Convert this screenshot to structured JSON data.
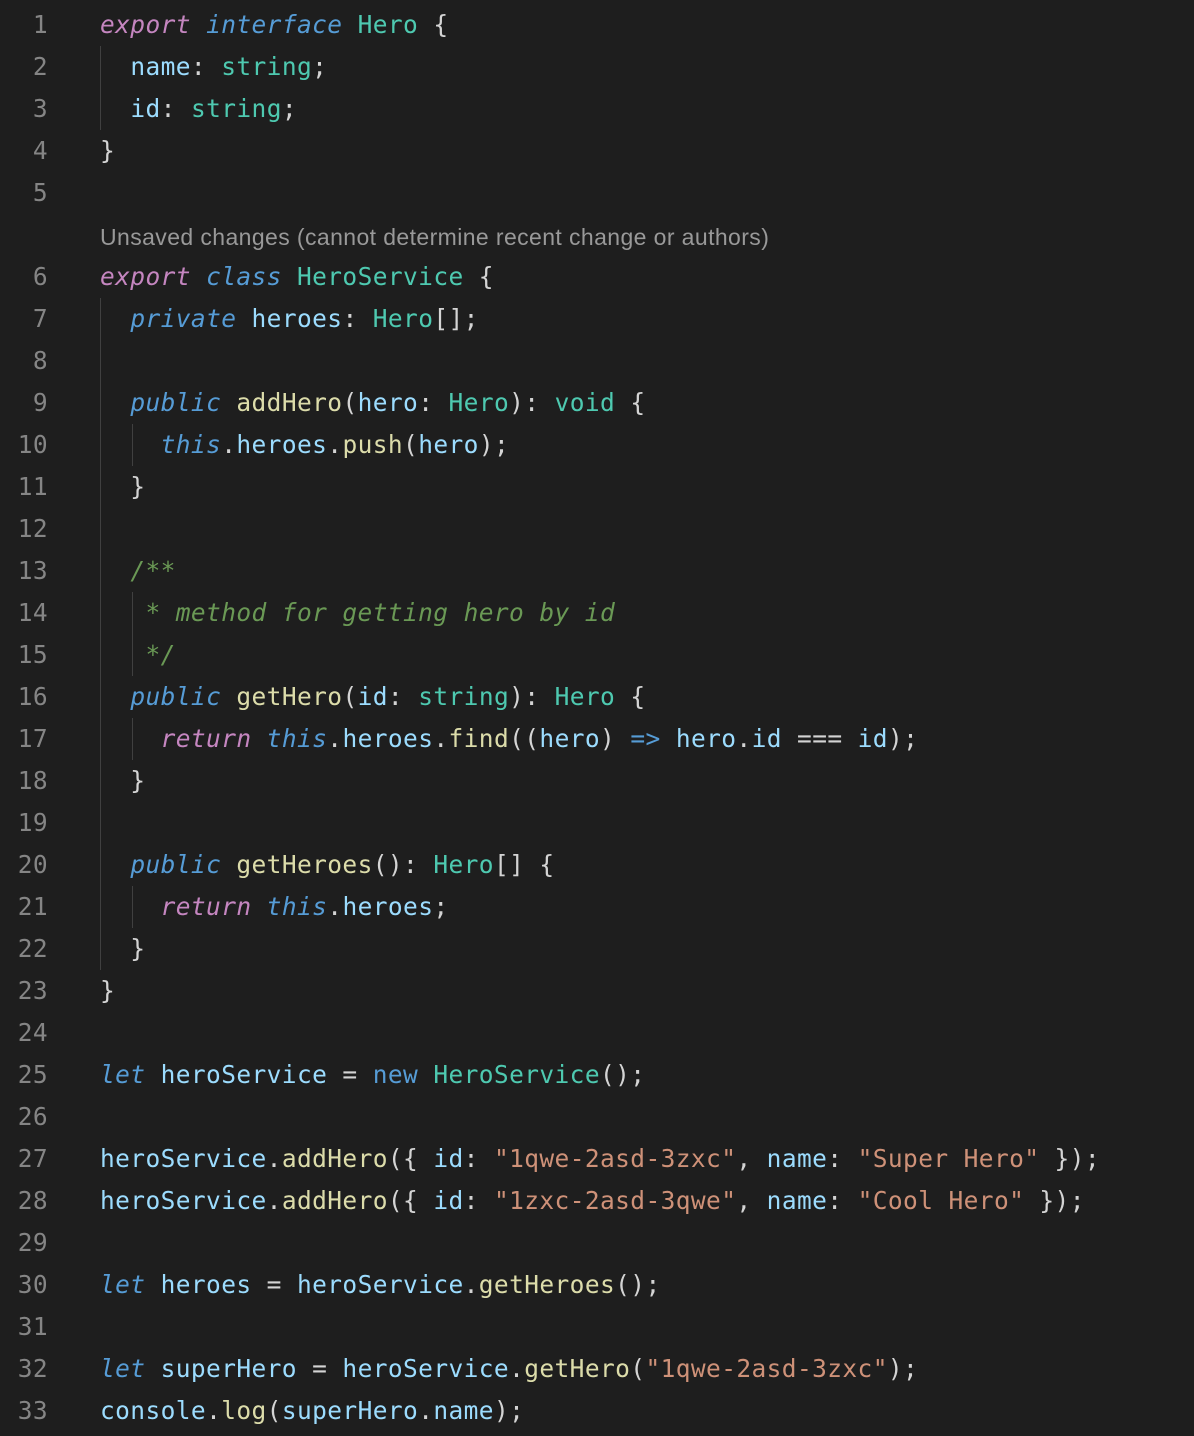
{
  "editor": {
    "codelens": "Unsaved changes (cannot determine recent change or authors)",
    "codelens_before_line": 6,
    "lines": [
      {
        "n": "1",
        "tokens": [
          [
            "kw-i",
            "export"
          ],
          [
            "pu",
            " "
          ],
          [
            "st-i",
            "interface"
          ],
          [
            "pu",
            " "
          ],
          [
            "ty",
            "Hero"
          ],
          [
            "pu",
            " {"
          ]
        ]
      },
      {
        "n": "2",
        "tokens": [
          [
            "pu",
            "  "
          ],
          [
            "vr",
            "name"
          ],
          [
            "pu",
            ": "
          ],
          [
            "ty",
            "string"
          ],
          [
            "pu",
            ";"
          ]
        ]
      },
      {
        "n": "3",
        "tokens": [
          [
            "pu",
            "  "
          ],
          [
            "vr",
            "id"
          ],
          [
            "pu",
            ": "
          ],
          [
            "ty",
            "string"
          ],
          [
            "pu",
            ";"
          ]
        ]
      },
      {
        "n": "4",
        "tokens": [
          [
            "pu",
            "}"
          ]
        ]
      },
      {
        "n": "5",
        "tokens": []
      },
      {
        "n": "6",
        "tokens": [
          [
            "kw-i",
            "export"
          ],
          [
            "pu",
            " "
          ],
          [
            "st-i",
            "class"
          ],
          [
            "pu",
            " "
          ],
          [
            "ty",
            "HeroService"
          ],
          [
            "pu",
            " {"
          ]
        ]
      },
      {
        "n": "7",
        "tokens": [
          [
            "pu",
            "  "
          ],
          [
            "st-i",
            "private"
          ],
          [
            "pu",
            " "
          ],
          [
            "vr",
            "heroes"
          ],
          [
            "pu",
            ": "
          ],
          [
            "ty",
            "Hero"
          ],
          [
            "pu",
            "[];"
          ]
        ]
      },
      {
        "n": "8",
        "tokens": []
      },
      {
        "n": "9",
        "tokens": [
          [
            "pu",
            "  "
          ],
          [
            "st-i",
            "public"
          ],
          [
            "pu",
            " "
          ],
          [
            "fn",
            "addHero"
          ],
          [
            "pu",
            "("
          ],
          [
            "vr",
            "hero"
          ],
          [
            "pu",
            ": "
          ],
          [
            "ty",
            "Hero"
          ],
          [
            "pu",
            "): "
          ],
          [
            "ty",
            "void"
          ],
          [
            "pu",
            " {"
          ]
        ]
      },
      {
        "n": "10",
        "tokens": [
          [
            "pu",
            "    "
          ],
          [
            "st-i",
            "this"
          ],
          [
            "pu",
            "."
          ],
          [
            "vr",
            "heroes"
          ],
          [
            "pu",
            "."
          ],
          [
            "fn",
            "push"
          ],
          [
            "pu",
            "("
          ],
          [
            "vr",
            "hero"
          ],
          [
            "pu",
            ");"
          ]
        ]
      },
      {
        "n": "11",
        "tokens": [
          [
            "pu",
            "  }"
          ]
        ]
      },
      {
        "n": "12",
        "tokens": []
      },
      {
        "n": "13",
        "tokens": [
          [
            "pu",
            "  "
          ],
          [
            "cm",
            "/**"
          ]
        ]
      },
      {
        "n": "14",
        "tokens": [
          [
            "pu",
            "   "
          ],
          [
            "cm",
            "* method for getting hero by id"
          ]
        ]
      },
      {
        "n": "15",
        "tokens": [
          [
            "pu",
            "   "
          ],
          [
            "cm",
            "*/"
          ]
        ]
      },
      {
        "n": "16",
        "tokens": [
          [
            "pu",
            "  "
          ],
          [
            "st-i",
            "public"
          ],
          [
            "pu",
            " "
          ],
          [
            "fn",
            "getHero"
          ],
          [
            "pu",
            "("
          ],
          [
            "vr",
            "id"
          ],
          [
            "pu",
            ": "
          ],
          [
            "ty",
            "string"
          ],
          [
            "pu",
            "): "
          ],
          [
            "ty",
            "Hero"
          ],
          [
            "pu",
            " {"
          ]
        ]
      },
      {
        "n": "17",
        "tokens": [
          [
            "pu",
            "    "
          ],
          [
            "kw-i",
            "return"
          ],
          [
            "pu",
            " "
          ],
          [
            "st-i",
            "this"
          ],
          [
            "pu",
            "."
          ],
          [
            "vr",
            "heroes"
          ],
          [
            "pu",
            "."
          ],
          [
            "fn",
            "find"
          ],
          [
            "pu",
            "(("
          ],
          [
            "vr",
            "hero"
          ],
          [
            "pu",
            ") "
          ],
          [
            "kw",
            "=>"
          ],
          [
            "pu",
            " "
          ],
          [
            "vr",
            "hero"
          ],
          [
            "pu",
            "."
          ],
          [
            "vr",
            "id"
          ],
          [
            "pu",
            " === "
          ],
          [
            "vr",
            "id"
          ],
          [
            "pu",
            ");"
          ]
        ]
      },
      {
        "n": "18",
        "tokens": [
          [
            "pu",
            "  }"
          ]
        ]
      },
      {
        "n": "19",
        "tokens": []
      },
      {
        "n": "20",
        "tokens": [
          [
            "pu",
            "  "
          ],
          [
            "st-i",
            "public"
          ],
          [
            "pu",
            " "
          ],
          [
            "fn",
            "getHeroes"
          ],
          [
            "pu",
            "(): "
          ],
          [
            "ty",
            "Hero"
          ],
          [
            "pu",
            "[] {"
          ]
        ]
      },
      {
        "n": "21",
        "tokens": [
          [
            "pu",
            "    "
          ],
          [
            "kw-i",
            "return"
          ],
          [
            "pu",
            " "
          ],
          [
            "st-i",
            "this"
          ],
          [
            "pu",
            "."
          ],
          [
            "vr",
            "heroes"
          ],
          [
            "pu",
            ";"
          ]
        ]
      },
      {
        "n": "22",
        "tokens": [
          [
            "pu",
            "  }"
          ]
        ]
      },
      {
        "n": "23",
        "tokens": [
          [
            "pu",
            "}"
          ]
        ]
      },
      {
        "n": "24",
        "tokens": []
      },
      {
        "n": "25",
        "tokens": [
          [
            "st-i",
            "let"
          ],
          [
            "pu",
            " "
          ],
          [
            "vr",
            "heroService"
          ],
          [
            "pu",
            " = "
          ],
          [
            "kw",
            "new"
          ],
          [
            "pu",
            " "
          ],
          [
            "ty",
            "HeroService"
          ],
          [
            "pu",
            "();"
          ]
        ]
      },
      {
        "n": "26",
        "tokens": []
      },
      {
        "n": "27",
        "tokens": [
          [
            "vr",
            "heroService"
          ],
          [
            "pu",
            "."
          ],
          [
            "fn",
            "addHero"
          ],
          [
            "pu",
            "({ "
          ],
          [
            "vr",
            "id"
          ],
          [
            "pu",
            ": "
          ],
          [
            "str",
            "\"1qwe-2asd-3zxc\""
          ],
          [
            "pu",
            ", "
          ],
          [
            "vr",
            "name"
          ],
          [
            "pu",
            ": "
          ],
          [
            "str",
            "\"Super Hero\""
          ],
          [
            "pu",
            " });"
          ]
        ]
      },
      {
        "n": "28",
        "tokens": [
          [
            "vr",
            "heroService"
          ],
          [
            "pu",
            "."
          ],
          [
            "fn",
            "addHero"
          ],
          [
            "pu",
            "({ "
          ],
          [
            "vr",
            "id"
          ],
          [
            "pu",
            ": "
          ],
          [
            "str",
            "\"1zxc-2asd-3qwe\""
          ],
          [
            "pu",
            ", "
          ],
          [
            "vr",
            "name"
          ],
          [
            "pu",
            ": "
          ],
          [
            "str",
            "\"Cool Hero\""
          ],
          [
            "pu",
            " });"
          ]
        ]
      },
      {
        "n": "29",
        "tokens": []
      },
      {
        "n": "30",
        "tokens": [
          [
            "st-i",
            "let"
          ],
          [
            "pu",
            " "
          ],
          [
            "vr",
            "heroes"
          ],
          [
            "pu",
            " = "
          ],
          [
            "vr",
            "heroService"
          ],
          [
            "pu",
            "."
          ],
          [
            "fn",
            "getHeroes"
          ],
          [
            "pu",
            "();"
          ]
        ]
      },
      {
        "n": "31",
        "tokens": []
      },
      {
        "n": "32",
        "tokens": [
          [
            "st-i",
            "let"
          ],
          [
            "pu",
            " "
          ],
          [
            "vr",
            "superHero"
          ],
          [
            "pu",
            " = "
          ],
          [
            "vr",
            "heroService"
          ],
          [
            "pu",
            "."
          ],
          [
            "fn",
            "getHero"
          ],
          [
            "pu",
            "("
          ],
          [
            "str",
            "\"1qwe-2asd-3zxc\""
          ],
          [
            "pu",
            ");"
          ]
        ]
      },
      {
        "n": "33",
        "tokens": [
          [
            "vr",
            "console"
          ],
          [
            "pu",
            "."
          ],
          [
            "fn",
            "log"
          ],
          [
            "pu",
            "("
          ],
          [
            "vr",
            "superHero"
          ],
          [
            "pu",
            "."
          ],
          [
            "vr",
            "name"
          ],
          [
            "pu",
            ");"
          ]
        ]
      }
    ]
  }
}
